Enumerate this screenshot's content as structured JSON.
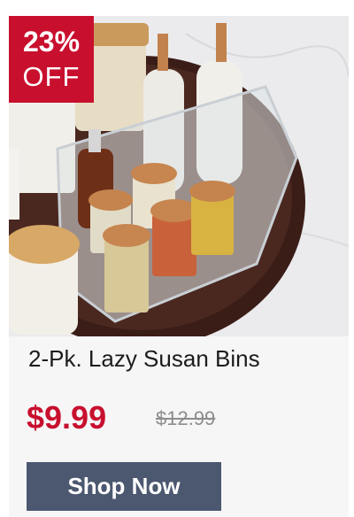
{
  "badge": {
    "percent": "23%",
    "off": "OFF"
  },
  "product": {
    "title": "2-Pk. Lazy Susan Bins",
    "price": "$9.99",
    "original_price": "$12.99",
    "image_icon": "product-photo-lazy-susan-bins"
  },
  "cta": {
    "label": "Shop Now"
  },
  "colors": {
    "badge_red": "#c8102e",
    "price_red": "#c8102e",
    "button_slate": "#4c5770",
    "strike_gray": "#8d8d8d"
  }
}
